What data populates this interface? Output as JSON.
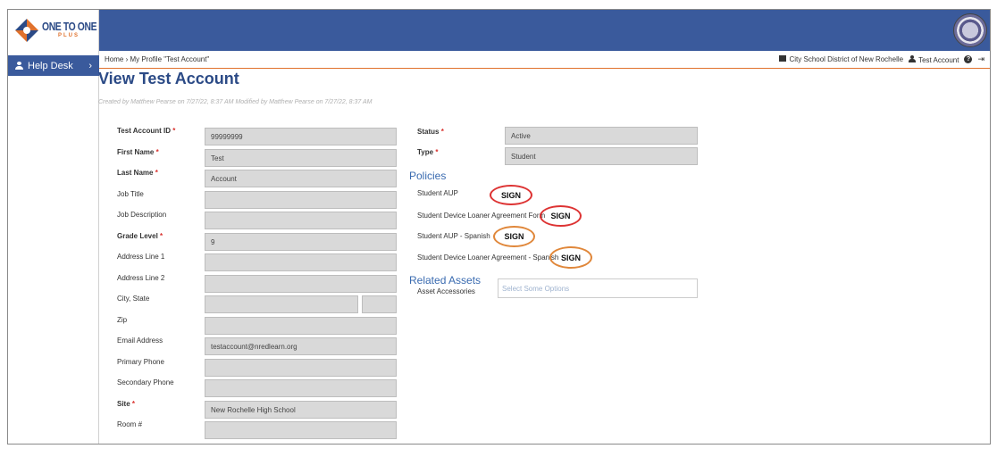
{
  "brand": {
    "logo_text": "ONE TO ONE",
    "logo_sub": "PLUS",
    "colors": {
      "primary": "#3a5a9c",
      "accent": "#e0712c",
      "title": "#2b4a86",
      "section": "#3a6bb0",
      "required": "#d9302c",
      "sign_red": "#dd3333",
      "sign_orange": "#e0873a"
    }
  },
  "sidebar": {
    "help_desk": "Help Desk",
    "chevron": "›"
  },
  "breadcrumb": {
    "path": "Home › My Profile \"Test Account\"",
    "district": "City School District of New Rochelle",
    "user": "Test Account",
    "help": "?",
    "logout": "⇥"
  },
  "page": {
    "title": "View Test Account",
    "meta": "Created by Matthew Pearse on 7/27/22, 8:37 AM     Modified by Matthew Pearse on 7/27/22, 8:37 AM"
  },
  "left_fields": [
    {
      "label": "Test Account ID",
      "required": true,
      "bold": true,
      "value": "99999999"
    },
    {
      "label": "First Name",
      "required": true,
      "bold": true,
      "value": "Test"
    },
    {
      "label": "Last Name",
      "required": true,
      "bold": true,
      "value": "Account"
    },
    {
      "label": "Job Title",
      "required": false,
      "bold": false,
      "value": ""
    },
    {
      "label": "Job Description",
      "required": false,
      "bold": false,
      "value": ""
    },
    {
      "label": "Grade Level",
      "required": true,
      "bold": true,
      "value": "9"
    },
    {
      "label": "Address Line 1",
      "required": false,
      "bold": false,
      "value": ""
    },
    {
      "label": "Address Line 2",
      "required": false,
      "bold": false,
      "value": ""
    },
    {
      "label": "City, State",
      "required": false,
      "bold": false,
      "value": ""
    },
    {
      "label": "Zip",
      "required": false,
      "bold": false,
      "value": ""
    },
    {
      "label": "Email Address",
      "required": false,
      "bold": false,
      "value": "testaccount@nredlearn.org"
    },
    {
      "label": "Primary Phone",
      "required": false,
      "bold": false,
      "value": ""
    },
    {
      "label": "Secondary Phone",
      "required": false,
      "bold": false,
      "value": ""
    },
    {
      "label": "Site",
      "required": true,
      "bold": true,
      "value": "New Rochelle High School"
    },
    {
      "label": "Room #",
      "required": false,
      "bold": false,
      "value": ""
    }
  ],
  "right_fields": [
    {
      "label": "Status",
      "required": true,
      "value": "Active"
    },
    {
      "label": "Type",
      "required": true,
      "value": "Student"
    }
  ],
  "required_marker": "*",
  "policies": {
    "heading": "Policies",
    "items": [
      {
        "label": "Student AUP",
        "action": "SIGN"
      },
      {
        "label": "Student Device Loaner Agreement Form",
        "action": "SIGN"
      },
      {
        "label": "Student AUP - Spanish",
        "action": "SIGN"
      },
      {
        "label": "Student Device Loaner Agreement - Spanish",
        "action": "SIGN"
      }
    ]
  },
  "related_assets": {
    "heading": "Related Assets",
    "accessories_label": "Asset Accessories",
    "accessories_placeholder": "Select Some Options"
  }
}
